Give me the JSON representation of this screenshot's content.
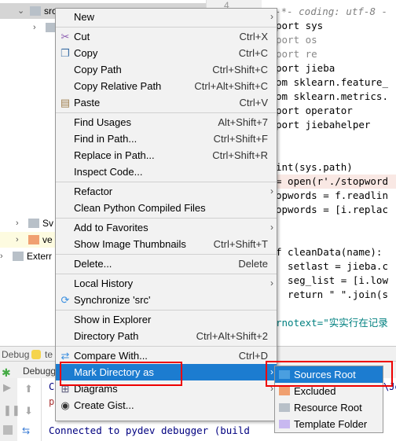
{
  "tree": {
    "rows": [
      {
        "label": "src",
        "chev": "v",
        "selected": true
      },
      {
        "label": "",
        "chev": ">"
      },
      {
        "label": ""
      },
      {
        "label": ""
      },
      {
        "label": ""
      },
      {
        "label": ""
      },
      {
        "label": ""
      },
      {
        "label": ""
      },
      {
        "label": ""
      },
      {
        "label": ""
      },
      {
        "label": ""
      },
      {
        "label": ""
      },
      {
        "label": ""
      },
      {
        "label": "Sv",
        "chev": ">"
      },
      {
        "label": "ve",
        "chev": ">"
      },
      {
        "label": "Exterr",
        "chev": ">"
      }
    ]
  },
  "editor": {
    "line_number": "4",
    "lines": [
      "# -*- coding: utf-8 -",
      "port sys",
      "port os",
      "port re",
      "port jieba",
      "om sklearn.feature_",
      "om sklearn.metrics.",
      "port operator",
      "port jiebahelper",
      "",
      "",
      "int(sys.path)",
      "= open(r'./stopword",
      "opwords = f.readlin",
      "opwords = [i.replac",
      "",
      "",
      "f cleanData(name):",
      "  setlast = jieba.c",
      "  seg_list = [i.low",
      "  return \" \".join(s",
      "",
      "rnotext=\"实实行在记录"
    ]
  },
  "debug": {
    "title": "Debug",
    "tab_prefix": "te",
    "subtab": "Debugg",
    "console": "Connected to pydev debugger (build",
    "console_c": "C",
    "console_p": "p",
    "console_right": "\\Je"
  },
  "menu": {
    "items": [
      {
        "label": "New",
        "arrow": true
      },
      {
        "sep": true
      },
      {
        "label": "Cut",
        "shortcut": "Ctrl+X",
        "icon": "scissors-icon"
      },
      {
        "label": "Copy",
        "shortcut": "Ctrl+C",
        "icon": "copy-icon"
      },
      {
        "label": "Copy Path",
        "shortcut": "Ctrl+Shift+C"
      },
      {
        "label": "Copy Relative Path",
        "shortcut": "Ctrl+Alt+Shift+C"
      },
      {
        "label": "Paste",
        "shortcut": "Ctrl+V",
        "icon": "paste-icon"
      },
      {
        "sep": true
      },
      {
        "label": "Find Usages",
        "shortcut": "Alt+Shift+7"
      },
      {
        "label": "Find in Path...",
        "shortcut": "Ctrl+Shift+F"
      },
      {
        "label": "Replace in Path...",
        "shortcut": "Ctrl+Shift+R"
      },
      {
        "label": "Inspect Code..."
      },
      {
        "sep": true
      },
      {
        "label": "Refactor",
        "arrow": true
      },
      {
        "label": "Clean Python Compiled Files"
      },
      {
        "sep": true
      },
      {
        "label": "Add to Favorites",
        "arrow": true
      },
      {
        "label": "Show Image Thumbnails",
        "shortcut": "Ctrl+Shift+T"
      },
      {
        "sep": true
      },
      {
        "label": "Delete...",
        "shortcut": "Delete"
      },
      {
        "sep": true
      },
      {
        "label": "Local History",
        "arrow": true
      },
      {
        "label": "Synchronize 'src'",
        "icon": "sync-icon"
      },
      {
        "sep": true
      },
      {
        "label": "Show in Explorer"
      },
      {
        "label": "Directory Path",
        "shortcut": "Ctrl+Alt+Shift+2"
      },
      {
        "sep": true
      },
      {
        "label": "Compare With...",
        "shortcut": "Ctrl+D",
        "icon": "compare-icon"
      },
      {
        "label": "Mark Directory as",
        "arrow": true,
        "active": true
      },
      {
        "label": "Diagrams",
        "arrow": true,
        "icon": "diagram-icon"
      },
      {
        "label": "Create Gist...",
        "icon": "github-icon"
      }
    ]
  },
  "submenu": {
    "items": [
      {
        "label": "Sources Root",
        "color": "#4a9fe0",
        "active": true
      },
      {
        "label": "Excluded",
        "color": "#f0a070"
      },
      {
        "label": "Resource Root",
        "color": "#b8c0c8"
      },
      {
        "label": "Template Folder",
        "color": "#c8b8f0"
      }
    ]
  },
  "colors": {
    "accent": "#1c7cd0",
    "highlight_box": "#e00000"
  }
}
